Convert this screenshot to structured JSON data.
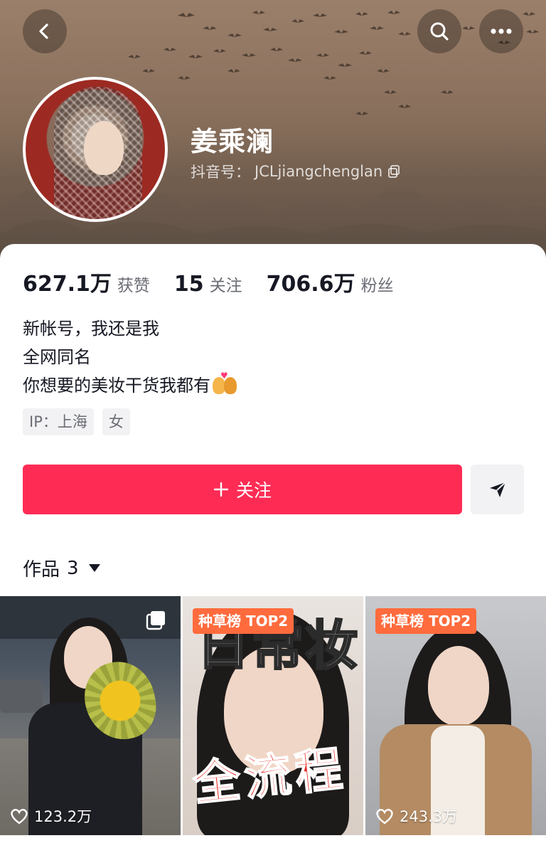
{
  "header": {
    "name": "姜乘澜",
    "douyin_id_label": "抖音号：",
    "douyin_id": "JCLjiangchenglan"
  },
  "stats": [
    {
      "value": "627.1万",
      "label": "获赞"
    },
    {
      "value": "15",
      "label": "关注"
    },
    {
      "value": "706.6万",
      "label": "粉丝"
    }
  ],
  "bio": {
    "line1": "新帐号，我还是我",
    "line2": "全网同名",
    "line3": "你想要的美妆干货我都有"
  },
  "tags": {
    "ip": "IP：上海",
    "gender": "女"
  },
  "actions": {
    "follow_label": "关注",
    "follow_color": "#fe2c55"
  },
  "works": {
    "label": "作品",
    "count": "3",
    "items": [
      {
        "likes": "123.2万",
        "type": "multi-image"
      },
      {
        "badge": "种草榜 TOP2",
        "overlay_top": "日常妆",
        "overlay_bottom": "全流程"
      },
      {
        "badge": "种草榜 TOP2",
        "likes": "243.3万"
      }
    ]
  }
}
